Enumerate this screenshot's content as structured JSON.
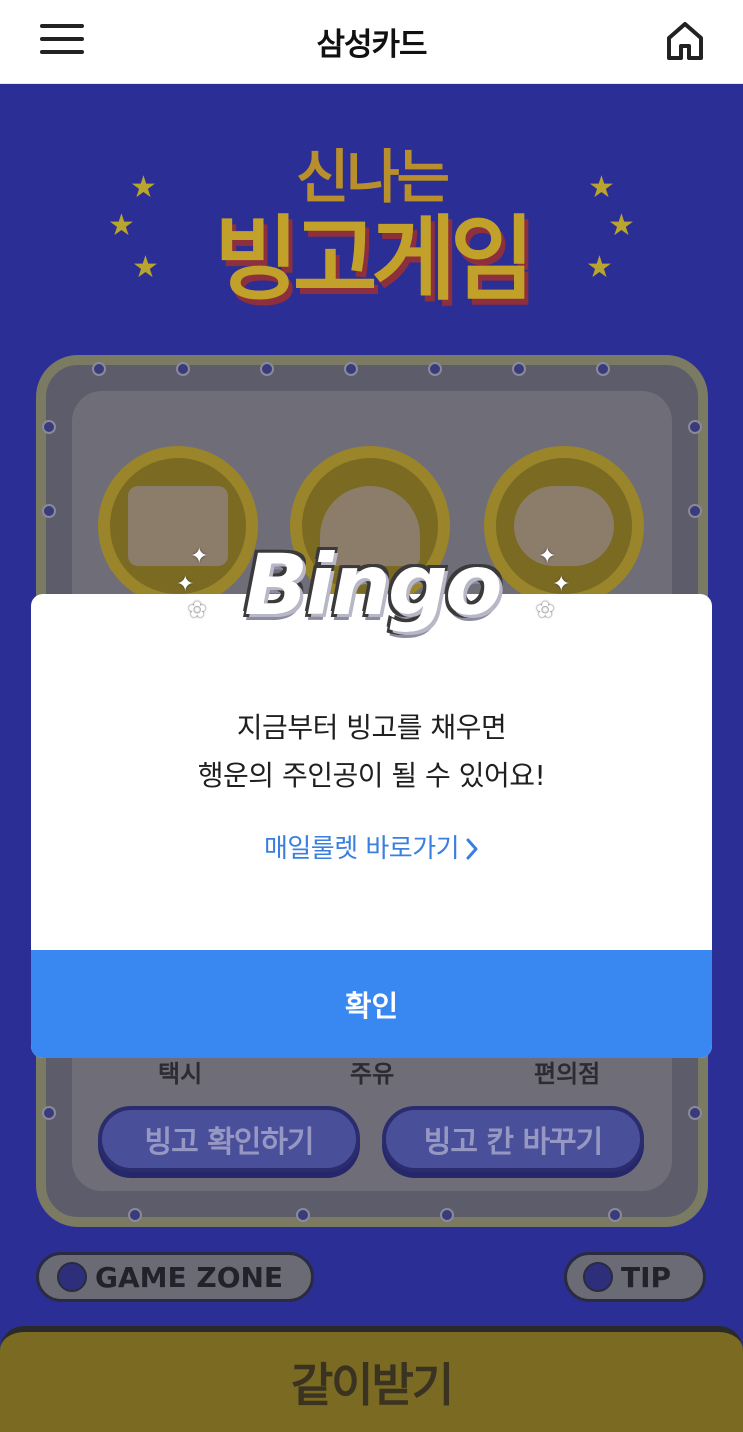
{
  "header": {
    "title": "삼성카드",
    "menu_icon": "menu-icon",
    "home_icon": "home-icon"
  },
  "game": {
    "title_top": "신나는",
    "title_main": "빙고게임",
    "categories": [
      "택시",
      "주유",
      "편의점"
    ],
    "check_button": "빙고 확인하기",
    "change_button": "빙고 칸 바꾸기",
    "game_zone": "GAME ZONE",
    "tip": "TIP",
    "bottom_button": "같이받기"
  },
  "modal": {
    "logo_text": "Bingo",
    "message_line1": "지금부터 빙고를 채우면",
    "message_line2": "행운의 주인공이 될 수 있어요!",
    "link_label": "매일룰렛 바로가기",
    "confirm_label": "확인"
  },
  "colors": {
    "primary": "#3987f0",
    "link": "#3a7fe0",
    "background": "#2a2c8e"
  }
}
